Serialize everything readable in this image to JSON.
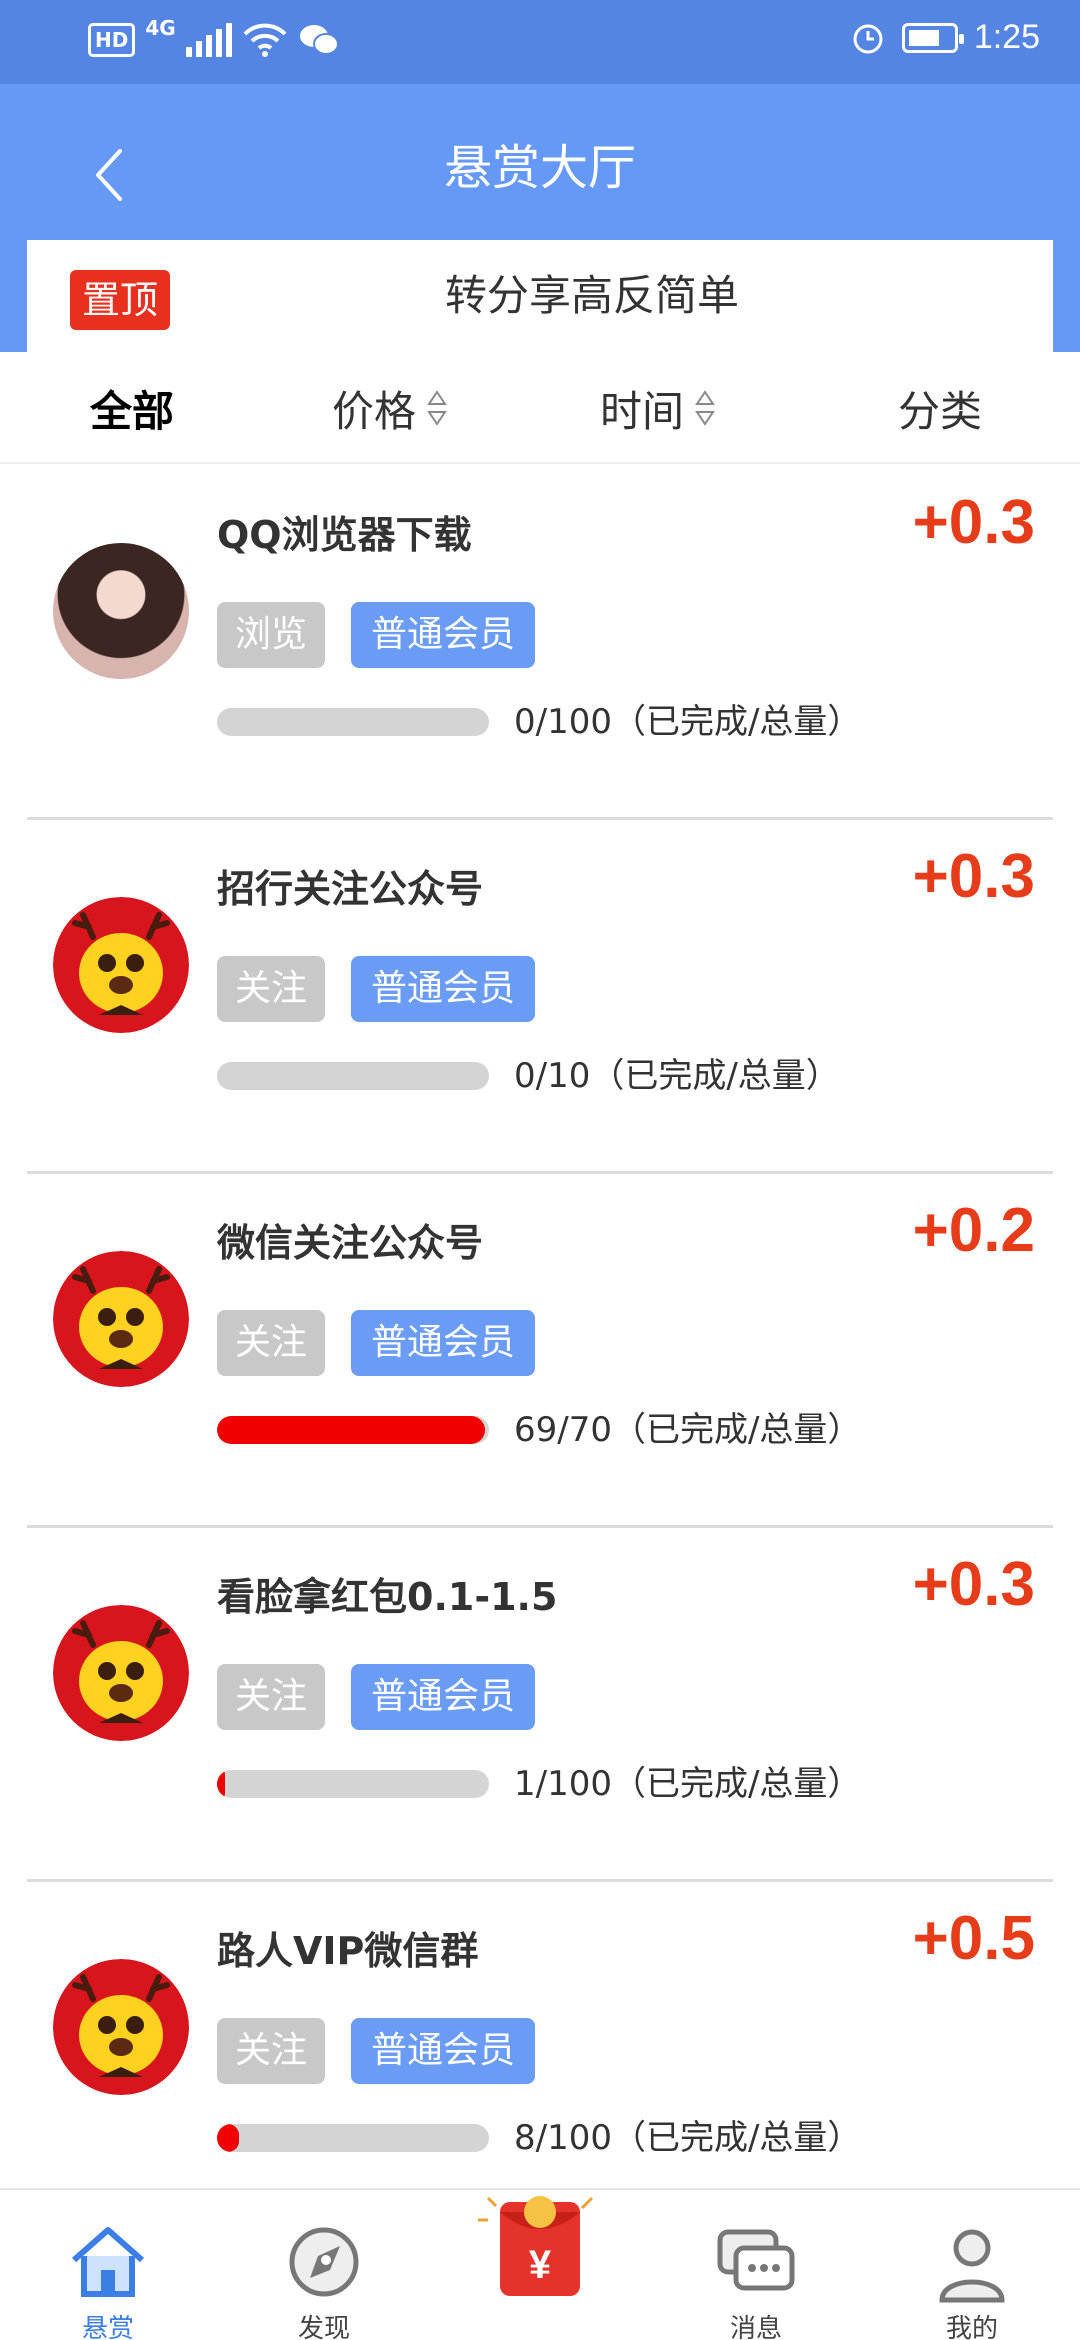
{
  "status_bar": {
    "hd": "HD",
    "network": "4G",
    "time": "1:25"
  },
  "header": {
    "title": "悬赏大厅"
  },
  "pinned": {
    "badge": "置顶",
    "text": "转分享高反简单"
  },
  "filters": [
    {
      "label": "全部",
      "active": true
    },
    {
      "label": "价格",
      "sortable": true
    },
    {
      "label": "时间",
      "sortable": true
    },
    {
      "label": "分类"
    }
  ],
  "tasks": [
    {
      "title": "QQ浏览器下载",
      "reward": "+0.3",
      "category": "浏览",
      "level": "普通会员",
      "completed": 0,
      "total": 100,
      "progress_text": "0/100（已完成/总量）",
      "avatar": "girl-photo"
    },
    {
      "title": "招行关注公众号",
      "reward": "+0.3",
      "category": "关注",
      "level": "普通会员",
      "completed": 0,
      "total": 10,
      "progress_text": "0/10（已完成/总量）",
      "avatar": "deer-mascot"
    },
    {
      "title": "微信关注公众号",
      "reward": "+0.2",
      "category": "关注",
      "level": "普通会员",
      "completed": 69,
      "total": 70,
      "progress_text": "69/70（已完成/总量）",
      "avatar": "deer-mascot"
    },
    {
      "title": "看脸拿红包0.1-1.5",
      "reward": "+0.3",
      "category": "关注",
      "level": "普通会员",
      "completed": 1,
      "total": 100,
      "progress_text": "1/100（已完成/总量）",
      "avatar": "deer-mascot"
    },
    {
      "title": "路人VIP微信群",
      "reward": "+0.5",
      "category": "关注",
      "level": "普通会员",
      "completed": 8,
      "total": 100,
      "progress_text": "8/100（已完成/总量）",
      "avatar": "deer-mascot"
    }
  ],
  "bottom_nav": [
    {
      "label": "悬赏",
      "icon": "house-icon",
      "active": true
    },
    {
      "label": "发现",
      "icon": "compass-icon"
    },
    {
      "label": "",
      "icon": "red-packet-icon"
    },
    {
      "label": "消息",
      "icon": "chat-icon"
    },
    {
      "label": "我的",
      "icon": "user-icon"
    }
  ],
  "colors": {
    "status_bar": "#5585e3",
    "header": "#6699f5",
    "reward": "#e63c1a",
    "progress": "#f00000",
    "tag_level": "#6a9cf5",
    "tag_category": "#c8c8c8",
    "nav_active": "#3a7ee6"
  }
}
